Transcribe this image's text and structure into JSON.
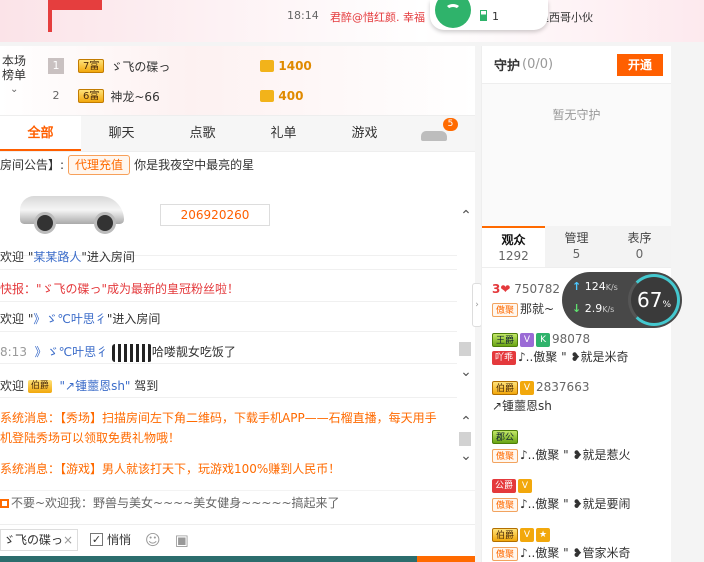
{
  "top": {
    "time": "18:14",
    "message": "君醉@惜红颜. 幸福",
    "message2": "趋西哥小伙",
    "wifi_count": "1"
  },
  "rank": {
    "title": "本场榜单",
    "rows": [
      {
        "num": "1",
        "badge": "7富",
        "name": "ゞ飞の碟っ",
        "value": "1400"
      },
      {
        "num": "2",
        "badge": "6富",
        "name": "神龙~66",
        "value": "400"
      }
    ]
  },
  "tabs": [
    "全部",
    "聊天",
    "点歌",
    "礼单",
    "游戏"
  ],
  "tab_badge": "5",
  "chat": {
    "notice_label": "房间公告】:",
    "notice_btn": "代理充值",
    "notice_text": "你是我夜空中最亮的星",
    "id": "206920260",
    "l1_pre": "欢迎 \"",
    "l1_name": "某某路人",
    "l1_post": "\"进入房间",
    "l2": "快报：\"ゞ飞の碟っ\"成为最新的皇冠粉丝啦！",
    "l3_pre": "欢迎 \"",
    "l3_name": "》ゞ℃叶思彳",
    "l3_post": "\"进入房间",
    "l4_time": "8:13",
    "l4_name": "》ゞ℃叶思彳",
    "l4_text": "哈喽靓女吃饭了",
    "l5_pre": "欢迎",
    "l5_badge": "伯爵",
    "l5_name": "\"↗锺蘁恩sh\"",
    "l5_post": "驾到",
    "sys1": "系统消息：【秀场】扫描房间左下角二维码，下载手机APP——石榴直播，每天用手机登陆秀场可以领取免费礼物哦！",
    "sys1a": "系统消息：【秀场】扫描房间左下角二维码，下载手机APP——石榴直播，每天用手",
    "sys1b": "机登陆秀场可以领取免费礼物哦！",
    "sys2": "系统消息：【游戏】男人就该打天下，玩游戏100%赚到人民币！",
    "ticker": "不要~欢迎我：野兽与美女~~~~美女健身~~~~~搞起来了"
  },
  "input": {
    "target": "ゞ飞の碟っ",
    "close": "×",
    "quiet_label": "悄悄",
    "quiet_checked": "✓"
  },
  "guard": {
    "title": "守护",
    "count": "(0/0)",
    "open_btn": "开通",
    "empty": "暂无守护"
  },
  "audience_tabs": [
    {
      "label": "观众",
      "count": "1292"
    },
    {
      "label": "管理",
      "count": "5"
    },
    {
      "label": "表序",
      "count": "0"
    }
  ],
  "audience": [
    {
      "rank": "3",
      "id": "750782",
      "badge": "傲聚",
      "name": "那就~"
    },
    {
      "badge1": "王爵",
      "id": "98078",
      "badge2": "吖乖",
      "name": "♪..傲聚 \" ❥就是米奇"
    },
    {
      "badge1": "伯爵",
      "id": "2837663",
      "name": "↗锺蘁恩sh"
    },
    {
      "badge1": "郡公",
      "badge2": "傲聚",
      "name": "♪..傲聚 \" ❥就是惹火"
    },
    {
      "badge1": "公爵",
      "badge2": "傲聚",
      "name": "♪..傲聚 \" ❥就是要闹"
    },
    {
      "badge1": "伯爵",
      "badge2": "傲聚",
      "name": "♪..傲聚 \" ❥管家米奇"
    }
  ],
  "speed": {
    "up": "124",
    "down": "2.9",
    "unit": "K/s",
    "percent": "67",
    "percent_sign": "%"
  }
}
